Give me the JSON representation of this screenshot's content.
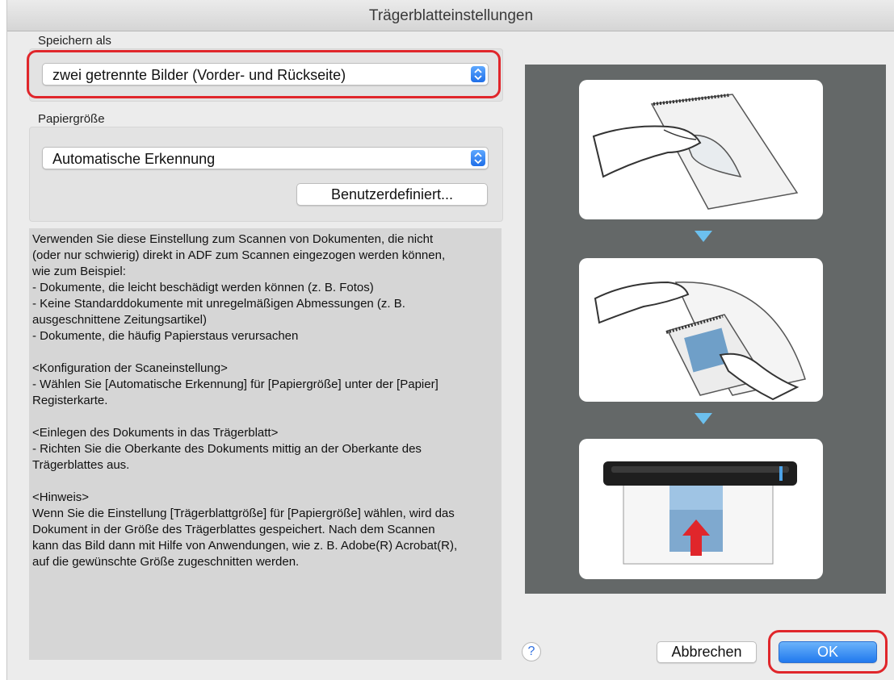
{
  "window": {
    "title": "Trägerblatteinstellungen"
  },
  "save_as": {
    "label": "Speichern als",
    "selected": "zwei getrennte Bilder (Vorder- und Rückseite)"
  },
  "paper_size": {
    "label": "Papiergröße",
    "selected": "Automatische Erkennung",
    "custom_button": "Benutzerdefiniert..."
  },
  "description": [
    "Verwenden Sie diese Einstellung zum Scannen von Dokumenten, die nicht",
    "(oder nur schwierig) direkt in ADF zum Scannen eingezogen werden können,",
    "wie zum Beispiel:",
    "- Dokumente, die leicht beschädigt werden können (z. B. Fotos)",
    "- Keine Standarddokumente mit unregelmäßigen Abmessungen (z. B.",
    "ausgeschnittene Zeitungsartikel)",
    "- Dokumente, die häufig Papierstaus verursachen",
    "",
    "<Konfiguration der Scaneinstellung>",
    "- Wählen Sie [Automatische Erkennung] für [Papiergröße] unter der [Papier]",
    "Registerkarte.",
    "",
    "<Einlegen des Dokuments in das Trägerblatt>",
    "- Richten Sie die Oberkante des Dokuments mittig an der Oberkante des",
    "Trägerblattes aus.",
    "",
    "<Hinweis>",
    "Wenn Sie die Einstellung [Trägerblattgröße] für [Papiergröße] wählen, wird das",
    "Dokument in der Größe des Trägerblattes gespeichert. Nach dem Scannen",
    "kann das Bild dann mit Hilfe von Anwendungen, wie z. B. Adobe(R) Acrobat(R),",
    "auf die gewünschte Größe zugeschnitten werden."
  ],
  "buttons": {
    "help": "?",
    "cancel": "Abbrechen",
    "ok": "OK"
  },
  "colors": {
    "highlight_ring": "#e0262b",
    "accent_blue": "#2079ee",
    "arrow_blue": "#6cc0ee"
  }
}
